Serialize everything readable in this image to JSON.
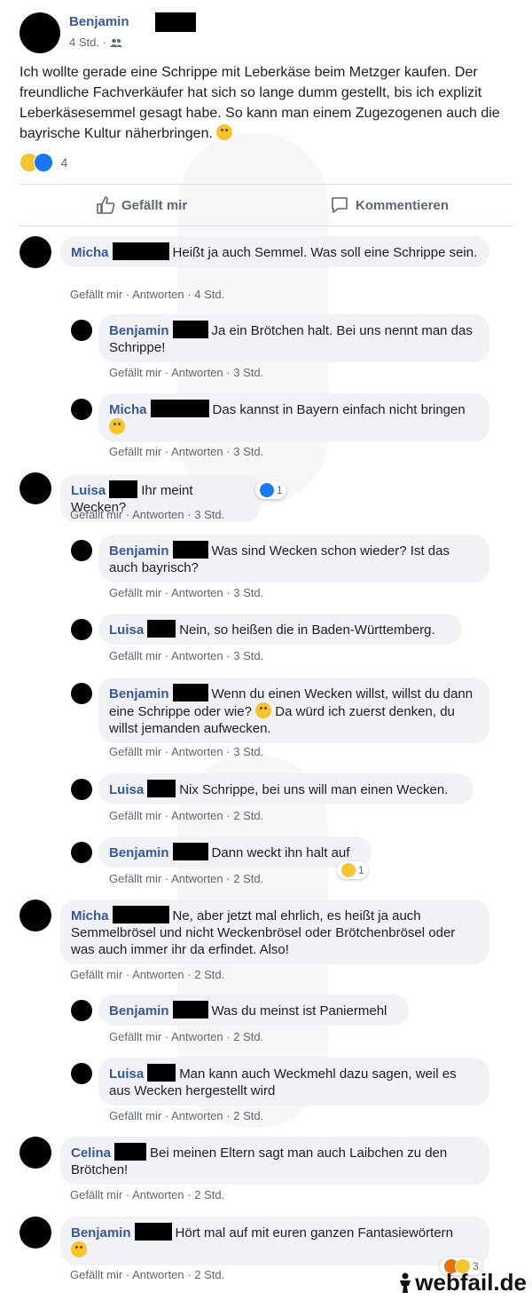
{
  "post": {
    "author": "Benjamin",
    "time": "4 Std. ·",
    "text": "Ich wollte gerade eine Schrippe mit Leberkäse beim Metzger kaufen. Der freundliche Fachverkäufer hat sich so lange dumm gestellt, bis ich explizit Leberkäsesemmel gesagt habe. So kann man einem Zugezogenen auch die bayrische Kultur näherbringen.",
    "reaction_count": "4",
    "like_label": "Gefällt mir",
    "comment_label": "Kommentieren"
  },
  "meta": {
    "like": "Gefällt mir",
    "reply": "Antworten",
    "sep": "·"
  },
  "comments": [
    {
      "name": "Micha",
      "text": "Heißt ja auch Semmel. Was soll eine Schrippe sein.",
      "time": "4 Std."
    },
    {
      "name": "Benjamin",
      "text": "Ja ein Brötchen halt. Bei uns nennt man das Schrippe!",
      "time": "3 Std."
    },
    {
      "name": "Micha",
      "text": "Das kannst in Bayern einfach nicht bringen",
      "time": "3 Std."
    },
    {
      "name": "Luisa",
      "text": "Ihr meint Wecken?",
      "time": "3 Std.",
      "react_count": "1"
    },
    {
      "name": "Benjamin",
      "text": "Was sind Wecken schon wieder? Ist das auch bayrisch?",
      "time": "3 Std."
    },
    {
      "name": "Luisa",
      "text": "Nein, so heißen die in Baden-Württemberg.",
      "time": "3 Std."
    },
    {
      "name": "Benjamin",
      "text": "Wenn du einen Wecken willst, willst du dann eine Schrippe oder wie?",
      "text2": "Da würd ich zuerst denken, du willst jemanden aufwecken.",
      "time": "3 Std."
    },
    {
      "name": "Luisa",
      "text": "Nix Schrippe, bei uns will man einen Wecken.",
      "time": "2 Std."
    },
    {
      "name": "Benjamin",
      "text": "Dann weckt ihn halt auf",
      "time": "2 Std.",
      "react_count": "1"
    },
    {
      "name": "Micha",
      "text": "Ne, aber jetzt mal ehrlich, es heißt ja auch Semmelbrösel und nicht Weckenbrösel oder Brötchenbrösel oder was auch immer ihr da erfindet. Also!",
      "time": "2 Std."
    },
    {
      "name": "Benjamin",
      "text": "Was du meinst ist Paniermehl",
      "time": "2 Std."
    },
    {
      "name": "Luisa",
      "text": "Man kann auch Weckmehl dazu sagen, weil es aus Wecken hergestellt wird",
      "time": "2 Std."
    },
    {
      "name": "Celina",
      "text": "Bei meinen Eltern sagt man auch Laibchen zu den Brötchen!",
      "time": "2 Std."
    },
    {
      "name": "Benjamin",
      "text": "Hört mal auf mit euren ganzen Fantasiewörtern",
      "time": "2 Std.",
      "react_count": "3"
    }
  ],
  "watermark": "webfail.de",
  "colors": {
    "name_link": "#385898",
    "bubble": "#f0f2f5",
    "meta": "#616770",
    "like_blue": "#1877f2"
  }
}
